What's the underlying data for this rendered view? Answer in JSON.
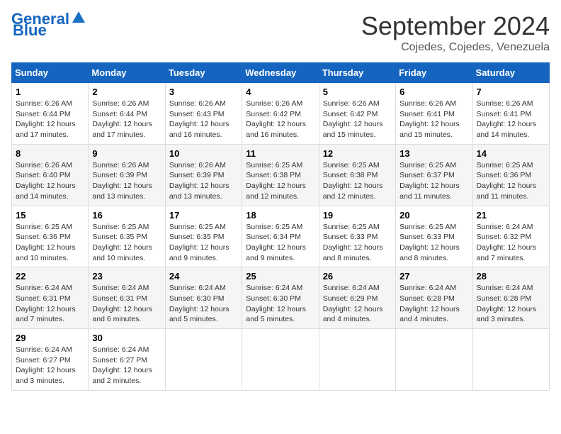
{
  "header": {
    "logo_line1": "General",
    "logo_line2": "Blue",
    "month": "September 2024",
    "location": "Cojedes, Cojedes, Venezuela"
  },
  "weekdays": [
    "Sunday",
    "Monday",
    "Tuesday",
    "Wednesday",
    "Thursday",
    "Friday",
    "Saturday"
  ],
  "weeks": [
    [
      {
        "day": "1",
        "sunrise": "6:26 AM",
        "sunset": "6:44 PM",
        "daylight": "12 hours and 17 minutes."
      },
      {
        "day": "2",
        "sunrise": "6:26 AM",
        "sunset": "6:44 PM",
        "daylight": "12 hours and 17 minutes."
      },
      {
        "day": "3",
        "sunrise": "6:26 AM",
        "sunset": "6:43 PM",
        "daylight": "12 hours and 16 minutes."
      },
      {
        "day": "4",
        "sunrise": "6:26 AM",
        "sunset": "6:42 PM",
        "daylight": "12 hours and 16 minutes."
      },
      {
        "day": "5",
        "sunrise": "6:26 AM",
        "sunset": "6:42 PM",
        "daylight": "12 hours and 15 minutes."
      },
      {
        "day": "6",
        "sunrise": "6:26 AM",
        "sunset": "6:41 PM",
        "daylight": "12 hours and 15 minutes."
      },
      {
        "day": "7",
        "sunrise": "6:26 AM",
        "sunset": "6:41 PM",
        "daylight": "12 hours and 14 minutes."
      }
    ],
    [
      {
        "day": "8",
        "sunrise": "6:26 AM",
        "sunset": "6:40 PM",
        "daylight": "12 hours and 14 minutes."
      },
      {
        "day": "9",
        "sunrise": "6:26 AM",
        "sunset": "6:39 PM",
        "daylight": "12 hours and 13 minutes."
      },
      {
        "day": "10",
        "sunrise": "6:26 AM",
        "sunset": "6:39 PM",
        "daylight": "12 hours and 13 minutes."
      },
      {
        "day": "11",
        "sunrise": "6:25 AM",
        "sunset": "6:38 PM",
        "daylight": "12 hours and 12 minutes."
      },
      {
        "day": "12",
        "sunrise": "6:25 AM",
        "sunset": "6:38 PM",
        "daylight": "12 hours and 12 minutes."
      },
      {
        "day": "13",
        "sunrise": "6:25 AM",
        "sunset": "6:37 PM",
        "daylight": "12 hours and 11 minutes."
      },
      {
        "day": "14",
        "sunrise": "6:25 AM",
        "sunset": "6:36 PM",
        "daylight": "12 hours and 11 minutes."
      }
    ],
    [
      {
        "day": "15",
        "sunrise": "6:25 AM",
        "sunset": "6:36 PM",
        "daylight": "12 hours and 10 minutes."
      },
      {
        "day": "16",
        "sunrise": "6:25 AM",
        "sunset": "6:35 PM",
        "daylight": "12 hours and 10 minutes."
      },
      {
        "day": "17",
        "sunrise": "6:25 AM",
        "sunset": "6:35 PM",
        "daylight": "12 hours and 9 minutes."
      },
      {
        "day": "18",
        "sunrise": "6:25 AM",
        "sunset": "6:34 PM",
        "daylight": "12 hours and 9 minutes."
      },
      {
        "day": "19",
        "sunrise": "6:25 AM",
        "sunset": "6:33 PM",
        "daylight": "12 hours and 8 minutes."
      },
      {
        "day": "20",
        "sunrise": "6:25 AM",
        "sunset": "6:33 PM",
        "daylight": "12 hours and 8 minutes."
      },
      {
        "day": "21",
        "sunrise": "6:24 AM",
        "sunset": "6:32 PM",
        "daylight": "12 hours and 7 minutes."
      }
    ],
    [
      {
        "day": "22",
        "sunrise": "6:24 AM",
        "sunset": "6:31 PM",
        "daylight": "12 hours and 7 minutes."
      },
      {
        "day": "23",
        "sunrise": "6:24 AM",
        "sunset": "6:31 PM",
        "daylight": "12 hours and 6 minutes."
      },
      {
        "day": "24",
        "sunrise": "6:24 AM",
        "sunset": "6:30 PM",
        "daylight": "12 hours and 5 minutes."
      },
      {
        "day": "25",
        "sunrise": "6:24 AM",
        "sunset": "6:30 PM",
        "daylight": "12 hours and 5 minutes."
      },
      {
        "day": "26",
        "sunrise": "6:24 AM",
        "sunset": "6:29 PM",
        "daylight": "12 hours and 4 minutes."
      },
      {
        "day": "27",
        "sunrise": "6:24 AM",
        "sunset": "6:28 PM",
        "daylight": "12 hours and 4 minutes."
      },
      {
        "day": "28",
        "sunrise": "6:24 AM",
        "sunset": "6:28 PM",
        "daylight": "12 hours and 3 minutes."
      }
    ],
    [
      {
        "day": "29",
        "sunrise": "6:24 AM",
        "sunset": "6:27 PM",
        "daylight": "12 hours and 3 minutes."
      },
      {
        "day": "30",
        "sunrise": "6:24 AM",
        "sunset": "6:27 PM",
        "daylight": "12 hours and 2 minutes."
      },
      null,
      null,
      null,
      null,
      null
    ]
  ]
}
